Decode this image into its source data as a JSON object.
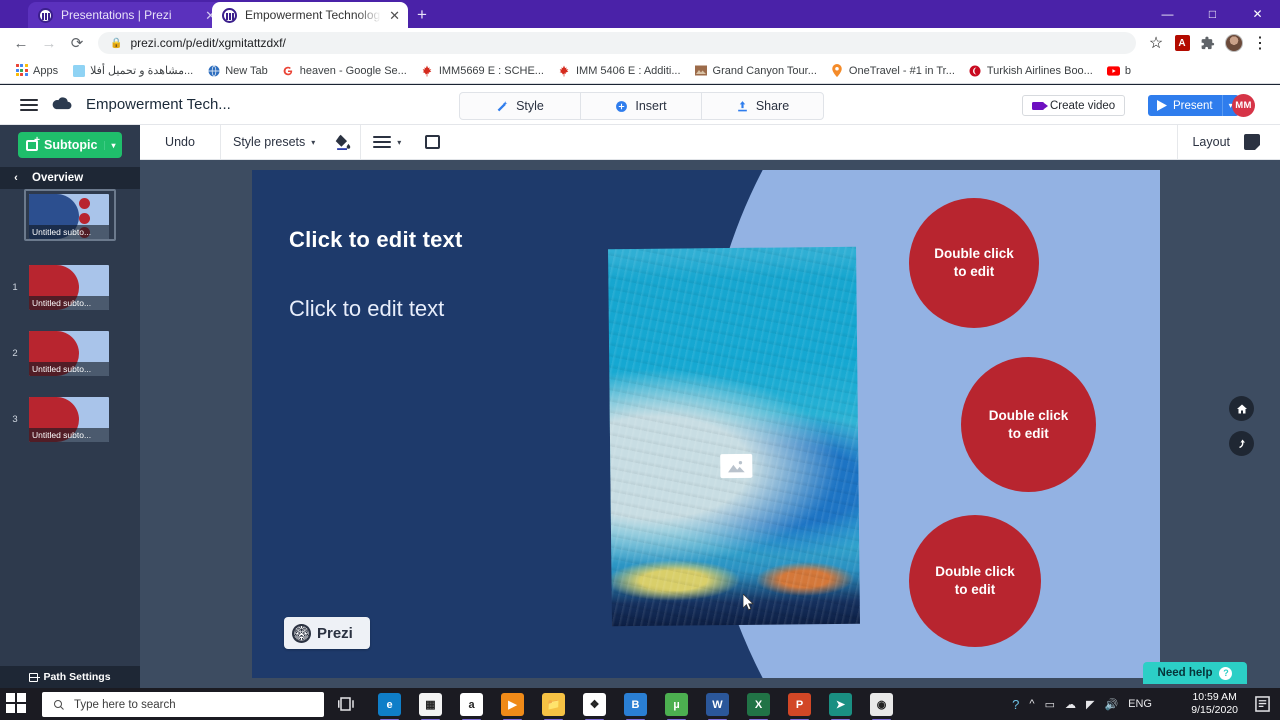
{
  "browser": {
    "tabs": [
      {
        "title": "Presentations | Prezi",
        "active": false,
        "favicon": "prezi-favicon"
      },
      {
        "title": "Empowerment Technologies | Pre",
        "active": true,
        "favicon": "prezi-favicon"
      }
    ],
    "new_tab_label": "+",
    "window_controls": {
      "minimize": "—",
      "maximize": "□",
      "close": "✕"
    },
    "nav": {
      "back": "←",
      "forward": "→",
      "reload": "⟳"
    },
    "omnibox": {
      "url": "prezi.com/p/edit/xgmitattzdxf/",
      "lock_icon": "lock-icon"
    },
    "toolbar_icons": {
      "star": "☆",
      "pdf": "A",
      "extensions": "puzzle-icon",
      "profile": "avatar-icon",
      "menu": "⋮"
    },
    "bookmarks": [
      {
        "label": "Apps",
        "icon": "apps-grid-icon",
        "color": "#4285f4"
      },
      {
        "label": "مشاهدة و تحميل أفلا...",
        "icon": "site-icon",
        "color": "#8fd3f4"
      },
      {
        "label": "New Tab",
        "icon": "globe-icon",
        "color": "#2f6fbf"
      },
      {
        "label": "heaven - Google Se...",
        "icon": "google-icon",
        "color": "#ea4335"
      },
      {
        "label": "IMM5669 E : SCHE...",
        "icon": "maple-leaf-icon",
        "color": "#d52b1e"
      },
      {
        "label": "IMM 5406 E : Additi...",
        "icon": "maple-leaf-icon",
        "color": "#d52b1e"
      },
      {
        "label": "Grand Canyon Tour...",
        "icon": "photo-icon",
        "color": "#9c6b4a"
      },
      {
        "label": "OneTravel - #1 in Tr...",
        "icon": "pin-icon",
        "color": "#f48b29"
      },
      {
        "label": "Turkish Airlines Boo...",
        "icon": "turkish-airlines-icon",
        "color": "#c90a20"
      },
      {
        "label": "b",
        "icon": "youtube-icon",
        "color": "#ff0000"
      }
    ]
  },
  "prezi": {
    "header": {
      "menu_icon": "hamburger-icon",
      "cloud_icon": "cloud-saved-icon",
      "doc_title": "Empowerment Tech...",
      "center_buttons": [
        {
          "label": "Style",
          "icon": "magic-wand-icon"
        },
        {
          "label": "Insert",
          "icon": "plus-circle-icon"
        },
        {
          "label": "Share",
          "icon": "upload-icon"
        }
      ],
      "create_video_label": "Create video",
      "create_video_icon": "video-camera-icon",
      "present_label": "Present",
      "present_icon": "play-icon",
      "present_caret": "▾",
      "user_initials": "MM"
    },
    "toolbar": {
      "undo_label": "Undo",
      "style_presets_label": "Style presets",
      "style_presets_caret": "▾",
      "fill_icon": "paint-bucket-icon",
      "lines_icon": "text-lines-icon",
      "lines_caret": "▾",
      "frame_icon": "frame-icon",
      "layout_label": "Layout",
      "layout_icon": "layout-panel-icon"
    },
    "sidebar": {
      "subtopic_button": {
        "label": "Subtopic",
        "icon": "add-frame-icon",
        "caret": "▾",
        "color": "#1fbe6b"
      },
      "overview_label": "Overview",
      "back_caret": "‹",
      "thumbnails": [
        {
          "number": "",
          "caption": "Untitled subto...",
          "selected": true,
          "style": "overview"
        },
        {
          "number": "1",
          "caption": "Untitled subto...",
          "selected": false,
          "style": "subtopic"
        },
        {
          "number": "2",
          "caption": "Untitled subto...",
          "selected": false,
          "style": "subtopic"
        },
        {
          "number": "3",
          "caption": "Untitled subto...",
          "selected": false,
          "style": "subtopic"
        }
      ],
      "path_settings_label": "Path Settings"
    },
    "slide": {
      "title": "Click to edit text",
      "subtitle": "Click to edit text",
      "image_placeholder_icon": "image-placeholder-icon",
      "logo_label": "Prezi",
      "circles": [
        {
          "line1": "Double click",
          "line2": "to edit"
        },
        {
          "line1": "Double click",
          "line2": "to edit"
        },
        {
          "line1": "Double click",
          "line2": "to edit"
        }
      ],
      "colors": {
        "dark_bg": "#1e3a6b",
        "light_bg": "#93b2e3",
        "circle": "#b8252f"
      }
    },
    "floating": {
      "home_icon": "home-icon",
      "back_up_icon": "step-back-icon"
    },
    "need_help": {
      "label": "Need help",
      "icon": "question-mark-icon",
      "color": "#2ccfc6"
    }
  },
  "taskbar": {
    "start_icon": "windows-start-icon",
    "search_placeholder": "Type here to search",
    "search_icon": "search-icon",
    "task_view_icon": "task-view-icon",
    "apps": [
      {
        "name": "microsoft-edge",
        "glyph": "e",
        "color": "#0f7ec8",
        "running": true
      },
      {
        "name": "microsoft-store",
        "glyph": "▦",
        "color": "#f3f3f3",
        "running": true
      },
      {
        "name": "amazon",
        "glyph": "a",
        "color": "#ffffff",
        "running": true
      },
      {
        "name": "vlc-media",
        "glyph": "▶",
        "color": "#ef8a18",
        "running": true
      },
      {
        "name": "file-explorer",
        "glyph": "📁",
        "color": "#f6c244",
        "running": true
      },
      {
        "name": "dropbox",
        "glyph": "❖",
        "color": "#ffffff",
        "running": true
      },
      {
        "name": "bitdefender",
        "glyph": "B",
        "color": "#2a7fd4",
        "running": true
      },
      {
        "name": "utorrent",
        "glyph": "µ",
        "color": "#4caf50",
        "running": true
      },
      {
        "name": "microsoft-word",
        "glyph": "W",
        "color": "#2b579a",
        "running": true
      },
      {
        "name": "microsoft-excel",
        "glyph": "X",
        "color": "#217346",
        "running": true
      },
      {
        "name": "microsoft-powerpoint",
        "glyph": "P",
        "color": "#d24726",
        "running": true
      },
      {
        "name": "teamviewer",
        "glyph": "➤",
        "color": "#1a8f82",
        "running": true
      },
      {
        "name": "google-chrome",
        "glyph": "◉",
        "color": "#e8e8e8",
        "running": true
      }
    ],
    "tray": {
      "help_icon": "help-circle-icon",
      "chevron_icon": "^",
      "hardware_icon": "usb-icon",
      "onedrive_icon": "cloud-icon",
      "network_icon": "wifi-icon",
      "volume_icon": "speaker-icon",
      "language": "ENG"
    },
    "clock": {
      "time": "10:59 AM",
      "date": "9/15/2020"
    },
    "notifications_icon": "action-center-icon"
  }
}
